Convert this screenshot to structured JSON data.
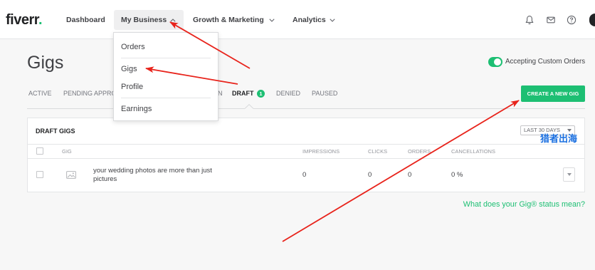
{
  "logo": {
    "text": "fiverr",
    "dot": "."
  },
  "nav": {
    "items": [
      {
        "label": "Dashboard"
      },
      {
        "label": "My Business",
        "icon": "chevron-up-icon",
        "active": true
      },
      {
        "label": "Growth & Marketing",
        "icon": "chevron-down-icon"
      },
      {
        "label": "Analytics",
        "icon": "chevron-down-icon"
      }
    ],
    "right_icons": [
      "bell-icon",
      "mail-icon",
      "help-icon",
      "avatar"
    ]
  },
  "dropdown": {
    "items": [
      {
        "label": "Orders"
      },
      {
        "label": "Gigs"
      },
      {
        "label": "Profile"
      },
      {
        "label": "Earnings"
      }
    ]
  },
  "page": {
    "title": "Gigs",
    "custom_orders": {
      "label": "Accepting Custom Orders",
      "enabled": true
    }
  },
  "tabs": [
    {
      "label": "ACTIVE"
    },
    {
      "label": "PENDING APPRO"
    },
    {
      "label": "N"
    },
    {
      "label": "DRAFT",
      "badge": "1",
      "selected": true
    },
    {
      "label": "DENIED"
    },
    {
      "label": "PAUSED"
    }
  ],
  "create_button": {
    "label": "CREATE A NEW GIG"
  },
  "table": {
    "title": "DRAFT GIGS",
    "range": "LAST 30 DAYS",
    "columns": [
      "GIG",
      "IMPRESSIONS",
      "CLICKS",
      "ORDERS",
      "CANCELLATIONS"
    ],
    "rows": [
      {
        "title": "your wedding photos are more than just pictures",
        "impressions": "0",
        "clicks": "0",
        "orders": "0",
        "cancellations": "0 %"
      }
    ]
  },
  "watermark": "猎者出海",
  "status_link": "What does your Gig® status mean?",
  "colors": {
    "brand": "#1dbf73",
    "annotation": "#e8231b",
    "watermark": "#1a6fe0",
    "text": "#404145"
  }
}
